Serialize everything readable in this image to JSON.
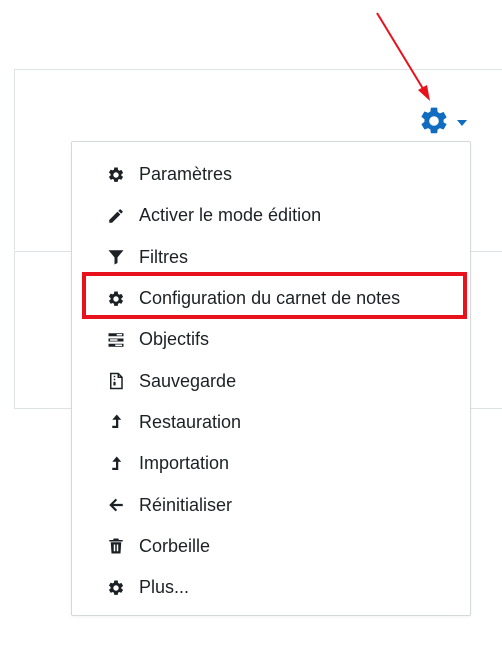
{
  "colors": {
    "accent": "#0f6cbf",
    "annotation": "#e8121d",
    "text": "#1d2125"
  },
  "trigger": {
    "icon": "gear-icon",
    "caret": "caret-down-icon"
  },
  "menu": {
    "items": [
      {
        "label": "Paramètres",
        "icon": "gear-icon"
      },
      {
        "label": "Activer le mode édition",
        "icon": "pencil-icon"
      },
      {
        "label": "Filtres",
        "icon": "filter-icon"
      },
      {
        "label": "Configuration du carnet de notes",
        "icon": "gear-icon",
        "highlighted": true
      },
      {
        "label": "Objectifs",
        "icon": "list-icon"
      },
      {
        "label": "Sauvegarde",
        "icon": "file-archive-icon"
      },
      {
        "label": "Restauration",
        "icon": "level-up-icon"
      },
      {
        "label": "Importation",
        "icon": "level-up-icon"
      },
      {
        "label": "Réinitialiser",
        "icon": "arrow-left-icon"
      },
      {
        "label": "Corbeille",
        "icon": "trash-icon"
      },
      {
        "label": "Plus...",
        "icon": "gear-icon"
      }
    ]
  }
}
